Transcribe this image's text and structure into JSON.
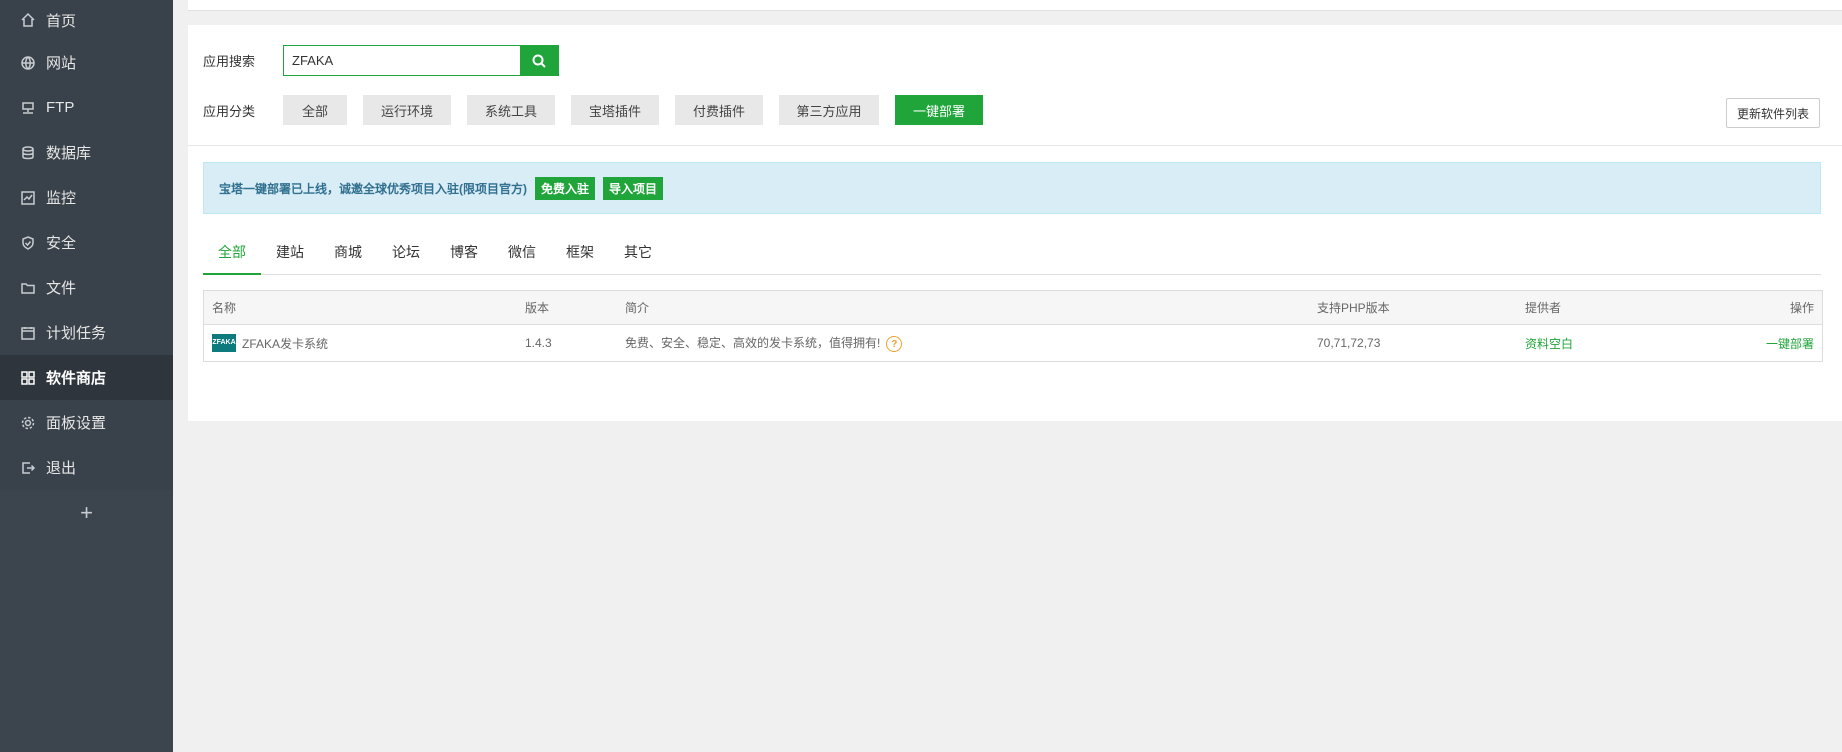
{
  "sidebar": {
    "items": [
      {
        "label": "首页",
        "icon": "home-icon"
      },
      {
        "label": "网站",
        "icon": "globe-icon"
      },
      {
        "label": "FTP",
        "icon": "ftp-icon"
      },
      {
        "label": "数据库",
        "icon": "database-icon"
      },
      {
        "label": "监控",
        "icon": "monitor-icon"
      },
      {
        "label": "安全",
        "icon": "shield-icon"
      },
      {
        "label": "文件",
        "icon": "folder-icon"
      },
      {
        "label": "计划任务",
        "icon": "calendar-icon"
      },
      {
        "label": "软件商店",
        "icon": "apps-icon",
        "active": true
      },
      {
        "label": "面板设置",
        "icon": "gear-icon"
      },
      {
        "label": "退出",
        "icon": "logout-icon"
      }
    ],
    "add_label": "+"
  },
  "search": {
    "label": "应用搜索",
    "value": "ZFAKA"
  },
  "categories": {
    "label": "应用分类",
    "items": [
      "全部",
      "运行环境",
      "系统工具",
      "宝塔插件",
      "付费插件",
      "第三方应用",
      "一键部署"
    ],
    "active": "一键部署"
  },
  "refresh_label": "更新软件列表",
  "alert": {
    "message": "宝塔一键部署已上线，诚邀全球优秀项目入驻(限项目官方)",
    "btn_free": "免费入驻",
    "btn_import": "导入项目"
  },
  "tabs": [
    "全部",
    "建站",
    "商城",
    "论坛",
    "博客",
    "微信",
    "框架",
    "其它"
  ],
  "table": {
    "headers": [
      "名称",
      "版本",
      "简介",
      "支持PHP版本",
      "提供者",
      "操作"
    ],
    "rows": [
      {
        "logo_text": "ZFAKA",
        "name": "ZFAKA发卡系统",
        "version": "1.4.3",
        "desc": "免费、安全、稳定、高效的发卡系统，值得拥有!",
        "php": "70,71,72,73",
        "provider": "资料空白",
        "action": "一键部署"
      }
    ]
  },
  "colors": {
    "accent": "#20a53a",
    "sidebar_bg": "#3c444d",
    "alert_bg": "#d9edf7",
    "alert_text": "#31708f"
  }
}
